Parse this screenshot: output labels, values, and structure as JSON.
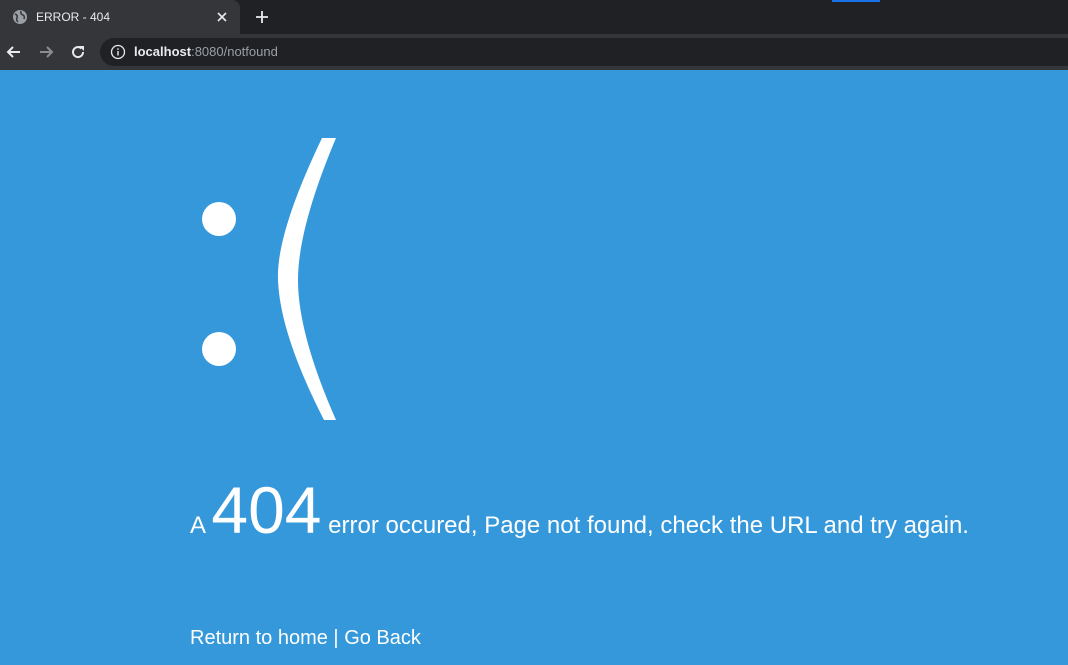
{
  "browser": {
    "tab": {
      "title": "ERROR - 404",
      "icon": "globe-icon",
      "close_icon": "close-icon"
    },
    "new_tab_icon": "plus-icon",
    "nav": {
      "back_icon": "back-arrow-icon",
      "forward_icon": "forward-arrow-icon",
      "reload_icon": "reload-icon"
    },
    "address_bar": {
      "info_icon": "info-icon",
      "host": "localhost",
      "rest": ":8080/notfound"
    }
  },
  "page": {
    "background_color": "#3498db",
    "emoticon": ":(",
    "message": {
      "prefix": "A",
      "code": "404",
      "suffix": "error occured, Page not found, check the URL and try again."
    },
    "links": {
      "home": "Return to home",
      "separator": "|",
      "back": "Go Back"
    }
  }
}
